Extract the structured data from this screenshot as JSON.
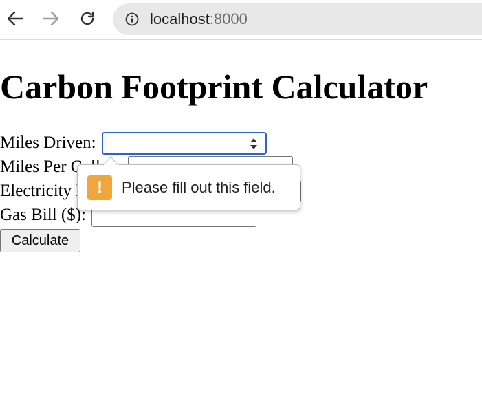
{
  "browser": {
    "url_host": "localhost",
    "url_port": ":8000",
    "icons": [
      "back-icon",
      "forward-icon",
      "reload-icon",
      "info-icon"
    ]
  },
  "page": {
    "title": "Carbon Footprint Calculator",
    "fields": [
      {
        "label": "Miles Driven:",
        "value": ""
      },
      {
        "label": "Miles Per Gallon:",
        "value": ""
      },
      {
        "label": "Electricity Bill ($):",
        "value": ""
      },
      {
        "label": "Gas Bill ($):",
        "value": ""
      }
    ],
    "button_label": "Calculate"
  },
  "validation": {
    "message": "Please fill out this field.",
    "icon_glyph": "!",
    "icon_color": "#f0a63a"
  },
  "colors": {
    "focus_ring": "#2a64c8"
  }
}
